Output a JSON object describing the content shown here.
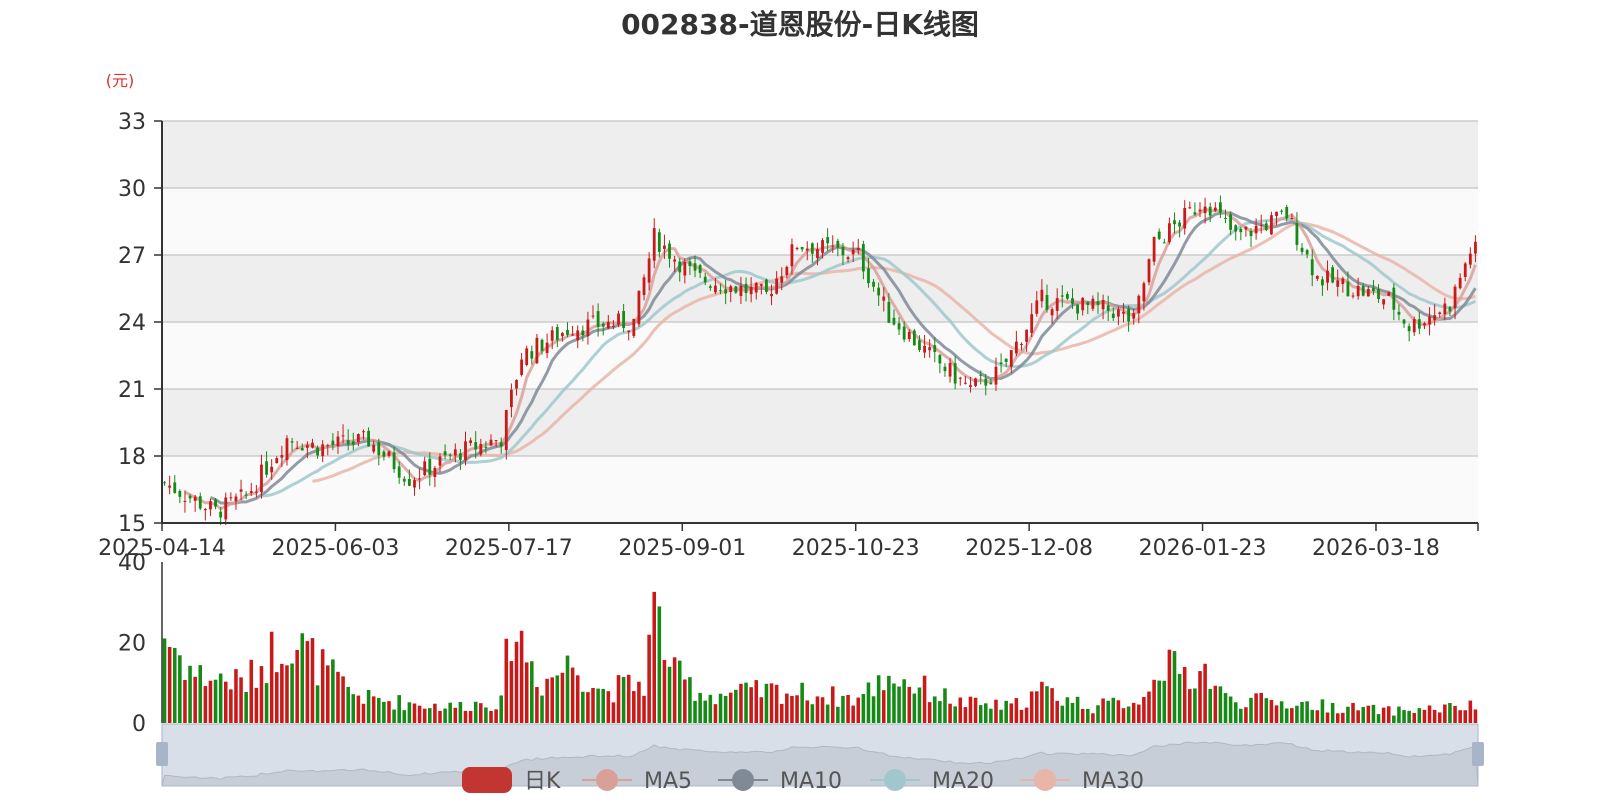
{
  "chart_data": {
    "type": "candlestick",
    "title": "002838-道恩股份-日K线图",
    "price_unit": "(元)",
    "price_axis": {
      "min": 15,
      "max": 33,
      "ticks": [
        15,
        18,
        21,
        24,
        27,
        30,
        33
      ]
    },
    "volume_axis": {
      "min": 0,
      "max": 40,
      "ticks": [
        0,
        20,
        40
      ]
    },
    "date_labels": [
      "2025-04-14",
      "2025-06-03",
      "2025-07-17",
      "2025-09-01",
      "2025-10-23",
      "2025-12-08",
      "2026-01-23",
      "2026-03-18"
    ],
    "date_label_positions": [
      0,
      34,
      68,
      102,
      136,
      170,
      204,
      238
    ],
    "up_color": "#c91a1a",
    "down_color": "#168a16",
    "series": [
      {
        "name": "日K",
        "color": "#c23531"
      },
      {
        "name": "MA5",
        "color": "#d9a09a"
      },
      {
        "name": "MA10",
        "color": "#808a96"
      },
      {
        "name": "MA20",
        "color": "#a0c8cc"
      },
      {
        "name": "MA30",
        "color": "#e8b5a8"
      }
    ],
    "close_anchors": [
      [
        0,
        16.8
      ],
      [
        10,
        15.5
      ],
      [
        16,
        16.2
      ],
      [
        24,
        18.8
      ],
      [
        30,
        18.4
      ],
      [
        40,
        18.7
      ],
      [
        48,
        17.0
      ],
      [
        58,
        18.2
      ],
      [
        66,
        18.8
      ],
      [
        70,
        22.5
      ],
      [
        80,
        23.8
      ],
      [
        92,
        24.0
      ],
      [
        96,
        27.8
      ],
      [
        104,
        26.0
      ],
      [
        118,
        25.2
      ],
      [
        124,
        27.5
      ],
      [
        136,
        27.0
      ],
      [
        142,
        24.3
      ],
      [
        150,
        22.5
      ],
      [
        158,
        21.0
      ],
      [
        164,
        21.8
      ],
      [
        172,
        25.0
      ],
      [
        186,
        24.5
      ],
      [
        190,
        24.0
      ],
      [
        194,
        27.5
      ],
      [
        204,
        29.5
      ],
      [
        210,
        27.8
      ],
      [
        220,
        28.8
      ],
      [
        226,
        26.0
      ],
      [
        240,
        25.0
      ],
      [
        244,
        23.8
      ],
      [
        252,
        24.8
      ],
      [
        256,
        27.2
      ]
    ],
    "volume_anchors": [
      [
        0,
        22
      ],
      [
        6,
        12
      ],
      [
        16,
        10
      ],
      [
        24,
        22
      ],
      [
        30,
        15
      ],
      [
        36,
        8
      ],
      [
        40,
        6
      ],
      [
        48,
        5
      ],
      [
        56,
        4
      ],
      [
        62,
        5
      ],
      [
        66,
        5
      ],
      [
        68,
        25
      ],
      [
        74,
        10
      ],
      [
        80,
        15
      ],
      [
        86,
        8
      ],
      [
        94,
        10
      ],
      [
        96,
        28
      ],
      [
        100,
        12
      ],
      [
        106,
        7
      ],
      [
        120,
        8
      ],
      [
        136,
        6
      ],
      [
        142,
        12
      ],
      [
        156,
        5
      ],
      [
        166,
        4
      ],
      [
        172,
        8
      ],
      [
        182,
        4
      ],
      [
        192,
        6
      ],
      [
        194,
        15
      ],
      [
        200,
        12
      ],
      [
        204,
        13
      ],
      [
        208,
        6
      ],
      [
        220,
        5
      ],
      [
        240,
        3
      ],
      [
        256,
        4
      ]
    ]
  }
}
